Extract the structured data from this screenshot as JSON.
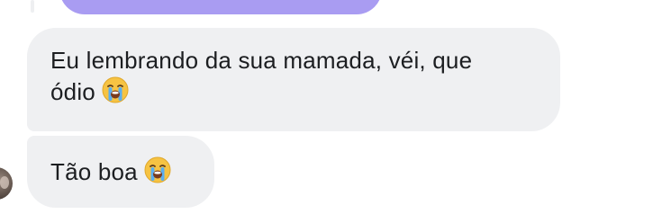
{
  "messages": [
    {
      "line1": "Eu lembrando da sua mamada, véi, que",
      "line2": "ódio",
      "emoji": "loudly-crying-face"
    },
    {
      "text": "Tão boa",
      "emoji": "loudly-crying-face"
    }
  ],
  "colors": {
    "sent_bubble": "#a99cf2",
    "received_bubble": "#eff0f2",
    "text": "#1c1e21"
  }
}
